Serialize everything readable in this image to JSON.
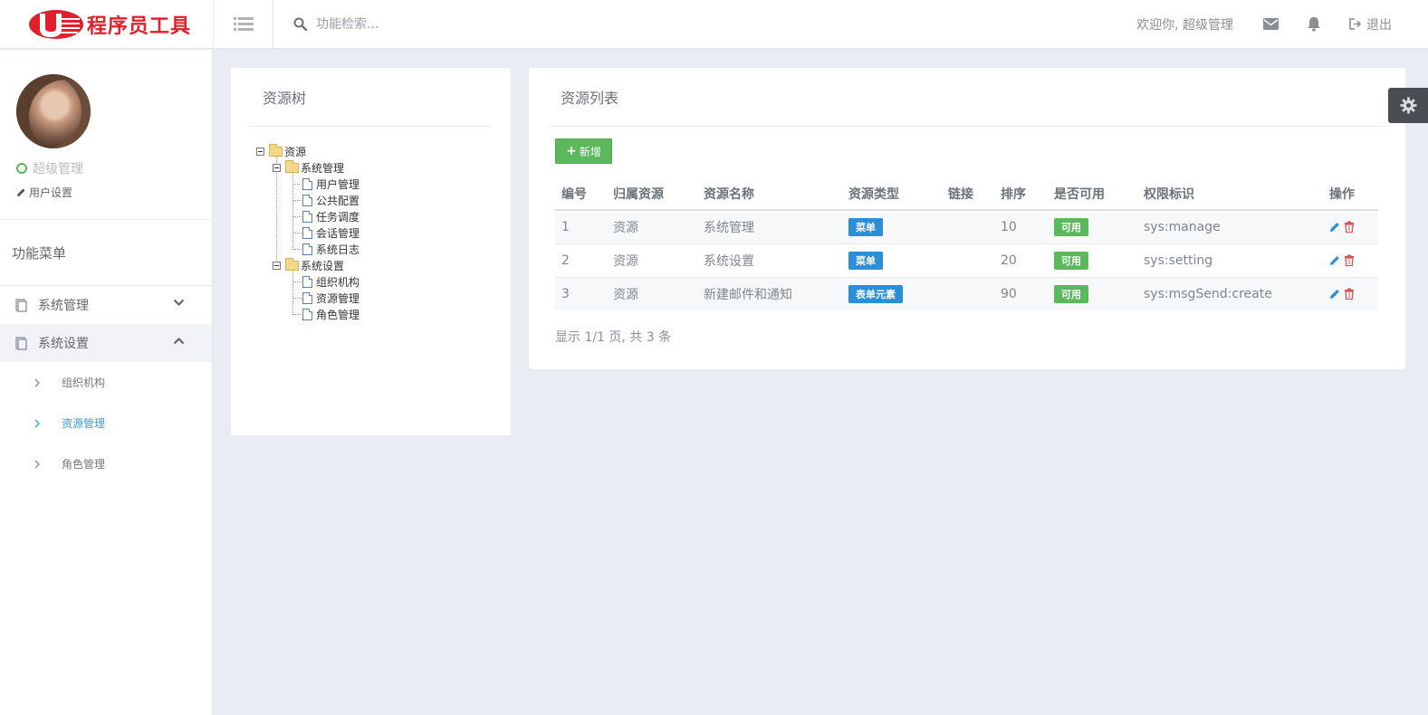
{
  "header": {
    "logo_text": "程序员工具",
    "search_placeholder": "功能检索...",
    "welcome": "欢迎你, 超级管理",
    "logout": "退出"
  },
  "sidebar": {
    "user_name": "超级管理",
    "user_settings": "用户设置",
    "menu_title": "功能菜单",
    "items": [
      {
        "label": "系统管理"
      },
      {
        "label": "系统设置"
      }
    ],
    "sub_items": [
      {
        "label": "组织机构"
      },
      {
        "label": "资源管理"
      },
      {
        "label": "角色管理"
      }
    ]
  },
  "tree_card": {
    "title": "资源树",
    "nodes": {
      "root": "资源",
      "sys_manage": "系统管理",
      "user_manage": "用户管理",
      "public_config": "公共配置",
      "task_schedule": "任务调度",
      "session_manage": "会话管理",
      "sys_log": "系统日志",
      "sys_setting": "系统设置",
      "org": "组织机构",
      "resource_manage": "资源管理",
      "role_manage": "角色管理"
    }
  },
  "list_card": {
    "title": "资源列表",
    "add_button": "新增",
    "columns": [
      "编号",
      "归属资源",
      "资源名称",
      "资源类型",
      "链接",
      "排序",
      "是否可用",
      "权限标识",
      "操作"
    ],
    "rows": [
      {
        "id": "1",
        "parent": "资源",
        "name": "系统管理",
        "type": "菜单",
        "link": "",
        "sort": "10",
        "enabled": "可用",
        "perm": "sys:manage"
      },
      {
        "id": "2",
        "parent": "资源",
        "name": "系统设置",
        "type": "菜单",
        "link": "",
        "sort": "20",
        "enabled": "可用",
        "perm": "sys:setting"
      },
      {
        "id": "3",
        "parent": "资源",
        "name": "新建邮件和通知",
        "type": "表单元素",
        "link": "",
        "sort": "90",
        "enabled": "可用",
        "perm": "sys:msgSend:create"
      }
    ],
    "pager": "显示 1/1 页, 共 3 条"
  },
  "colors": {
    "brand_red": "#e0202a",
    "success_green": "#5cb85c",
    "info_blue": "#2b8ed8",
    "active_link": "#3a9bd9"
  }
}
